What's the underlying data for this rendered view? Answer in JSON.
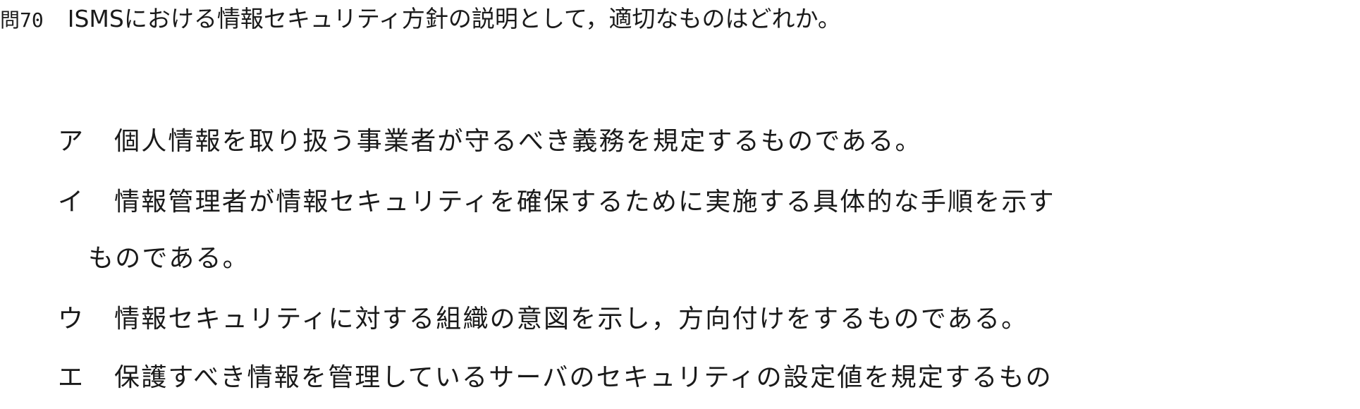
{
  "question": {
    "number": "問70",
    "text": "ISMSにおける情報セキュリティ方針の説明として，適切なものはどれか。"
  },
  "options": [
    {
      "label": "ア",
      "text": "個人情報を取り扱う事業者が守るべき義務を規定するものである。"
    },
    {
      "label": "イ",
      "text": "情報管理者が情報セキュリティを確保するために実施する具体的な手順を示す",
      "continuation": "ものである。"
    },
    {
      "label": "ウ",
      "text": "情報セキュリティに対する組織の意図を示し，方向付けをするものである。"
    },
    {
      "label": "エ",
      "text": "保護すべき情報を管理しているサーバのセキュリティの設定値を規定するもの"
    }
  ]
}
